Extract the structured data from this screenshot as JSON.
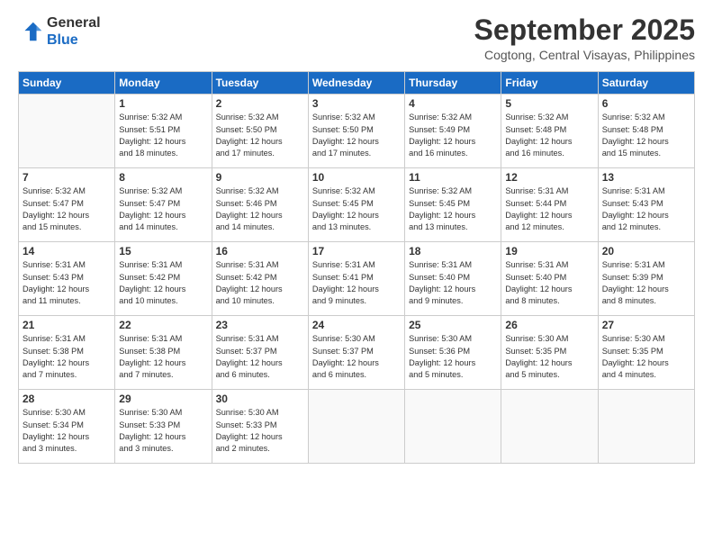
{
  "logo": {
    "line1": "General",
    "line2": "Blue"
  },
  "title": "September 2025",
  "location": "Cogtong, Central Visayas, Philippines",
  "days_of_week": [
    "Sunday",
    "Monday",
    "Tuesday",
    "Wednesday",
    "Thursday",
    "Friday",
    "Saturday"
  ],
  "weeks": [
    [
      {
        "day": "",
        "info": ""
      },
      {
        "day": "1",
        "info": "Sunrise: 5:32 AM\nSunset: 5:51 PM\nDaylight: 12 hours\nand 18 minutes."
      },
      {
        "day": "2",
        "info": "Sunrise: 5:32 AM\nSunset: 5:50 PM\nDaylight: 12 hours\nand 17 minutes."
      },
      {
        "day": "3",
        "info": "Sunrise: 5:32 AM\nSunset: 5:50 PM\nDaylight: 12 hours\nand 17 minutes."
      },
      {
        "day": "4",
        "info": "Sunrise: 5:32 AM\nSunset: 5:49 PM\nDaylight: 12 hours\nand 16 minutes."
      },
      {
        "day": "5",
        "info": "Sunrise: 5:32 AM\nSunset: 5:48 PM\nDaylight: 12 hours\nand 16 minutes."
      },
      {
        "day": "6",
        "info": "Sunrise: 5:32 AM\nSunset: 5:48 PM\nDaylight: 12 hours\nand 15 minutes."
      }
    ],
    [
      {
        "day": "7",
        "info": "Sunrise: 5:32 AM\nSunset: 5:47 PM\nDaylight: 12 hours\nand 15 minutes."
      },
      {
        "day": "8",
        "info": "Sunrise: 5:32 AM\nSunset: 5:47 PM\nDaylight: 12 hours\nand 14 minutes."
      },
      {
        "day": "9",
        "info": "Sunrise: 5:32 AM\nSunset: 5:46 PM\nDaylight: 12 hours\nand 14 minutes."
      },
      {
        "day": "10",
        "info": "Sunrise: 5:32 AM\nSunset: 5:45 PM\nDaylight: 12 hours\nand 13 minutes."
      },
      {
        "day": "11",
        "info": "Sunrise: 5:32 AM\nSunset: 5:45 PM\nDaylight: 12 hours\nand 13 minutes."
      },
      {
        "day": "12",
        "info": "Sunrise: 5:31 AM\nSunset: 5:44 PM\nDaylight: 12 hours\nand 12 minutes."
      },
      {
        "day": "13",
        "info": "Sunrise: 5:31 AM\nSunset: 5:43 PM\nDaylight: 12 hours\nand 12 minutes."
      }
    ],
    [
      {
        "day": "14",
        "info": "Sunrise: 5:31 AM\nSunset: 5:43 PM\nDaylight: 12 hours\nand 11 minutes."
      },
      {
        "day": "15",
        "info": "Sunrise: 5:31 AM\nSunset: 5:42 PM\nDaylight: 12 hours\nand 10 minutes."
      },
      {
        "day": "16",
        "info": "Sunrise: 5:31 AM\nSunset: 5:42 PM\nDaylight: 12 hours\nand 10 minutes."
      },
      {
        "day": "17",
        "info": "Sunrise: 5:31 AM\nSunset: 5:41 PM\nDaylight: 12 hours\nand 9 minutes."
      },
      {
        "day": "18",
        "info": "Sunrise: 5:31 AM\nSunset: 5:40 PM\nDaylight: 12 hours\nand 9 minutes."
      },
      {
        "day": "19",
        "info": "Sunrise: 5:31 AM\nSunset: 5:40 PM\nDaylight: 12 hours\nand 8 minutes."
      },
      {
        "day": "20",
        "info": "Sunrise: 5:31 AM\nSunset: 5:39 PM\nDaylight: 12 hours\nand 8 minutes."
      }
    ],
    [
      {
        "day": "21",
        "info": "Sunrise: 5:31 AM\nSunset: 5:38 PM\nDaylight: 12 hours\nand 7 minutes."
      },
      {
        "day": "22",
        "info": "Sunrise: 5:31 AM\nSunset: 5:38 PM\nDaylight: 12 hours\nand 7 minutes."
      },
      {
        "day": "23",
        "info": "Sunrise: 5:31 AM\nSunset: 5:37 PM\nDaylight: 12 hours\nand 6 minutes."
      },
      {
        "day": "24",
        "info": "Sunrise: 5:30 AM\nSunset: 5:37 PM\nDaylight: 12 hours\nand 6 minutes."
      },
      {
        "day": "25",
        "info": "Sunrise: 5:30 AM\nSunset: 5:36 PM\nDaylight: 12 hours\nand 5 minutes."
      },
      {
        "day": "26",
        "info": "Sunrise: 5:30 AM\nSunset: 5:35 PM\nDaylight: 12 hours\nand 5 minutes."
      },
      {
        "day": "27",
        "info": "Sunrise: 5:30 AM\nSunset: 5:35 PM\nDaylight: 12 hours\nand 4 minutes."
      }
    ],
    [
      {
        "day": "28",
        "info": "Sunrise: 5:30 AM\nSunset: 5:34 PM\nDaylight: 12 hours\nand 3 minutes."
      },
      {
        "day": "29",
        "info": "Sunrise: 5:30 AM\nSunset: 5:33 PM\nDaylight: 12 hours\nand 3 minutes."
      },
      {
        "day": "30",
        "info": "Sunrise: 5:30 AM\nSunset: 5:33 PM\nDaylight: 12 hours\nand 2 minutes."
      },
      {
        "day": "",
        "info": ""
      },
      {
        "day": "",
        "info": ""
      },
      {
        "day": "",
        "info": ""
      },
      {
        "day": "",
        "info": ""
      }
    ]
  ]
}
